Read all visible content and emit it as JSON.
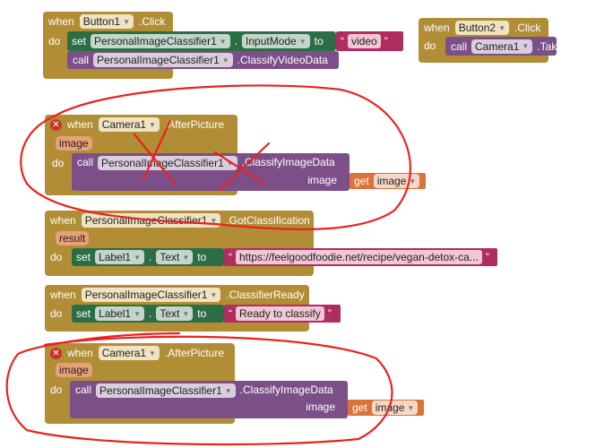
{
  "kw": {
    "when": "when",
    "do": "do",
    "set": "set",
    "call": "call",
    "to": "to",
    "get": "get",
    "dot": ".",
    "quote": "“",
    "quote_end": "”"
  },
  "blocks": [
    {
      "component": "Button1",
      "event": ".Click",
      "set": {
        "component": "PersonalImageClassifier1",
        "property": "InputMode",
        "value": "video"
      },
      "call": {
        "component": "PersonalImageClassifier1",
        "method": ".ClassifyVideoData"
      }
    },
    {
      "component": "Button2",
      "event": ".Click",
      "call": {
        "component": "Camera1",
        "method": ".TakePicture"
      }
    },
    {
      "component": "Camera1",
      "event": ".AfterPicture",
      "param": "image",
      "error": true,
      "call": {
        "component": "PersonalImageClassifier1",
        "method": ".ClassifyImageData",
        "arg_label": "image",
        "arg_value": "image"
      }
    },
    {
      "component": "PersonalImageClassifier1",
      "event": ".GotClassification",
      "param": "result",
      "set": {
        "component": "Label1",
        "property": "Text",
        "value": "https://feelgoodfoodie.net/recipe/vegan-detox-ca..."
      }
    },
    {
      "component": "PersonalImageClassifier1",
      "event": ".ClassifierReady",
      "set": {
        "component": "Label1",
        "property": "Text",
        "value": "Ready to classify"
      }
    },
    {
      "component": "Camera1",
      "event": ".AfterPicture",
      "param": "image",
      "error": true,
      "call": {
        "component": "PersonalImageClassifier1",
        "method": ".ClassifyImageData",
        "arg_label": "image",
        "arg_value": "image"
      }
    }
  ],
  "colors": {
    "event": "#b18e35",
    "set": "#2b6e46",
    "call": "#7c4f88",
    "text": "#b02d5f",
    "get": "#d9733a",
    "annotation": "#e8231f"
  },
  "icons": {
    "error": "error-x-icon",
    "dropdown": "chevron-down-icon"
  }
}
